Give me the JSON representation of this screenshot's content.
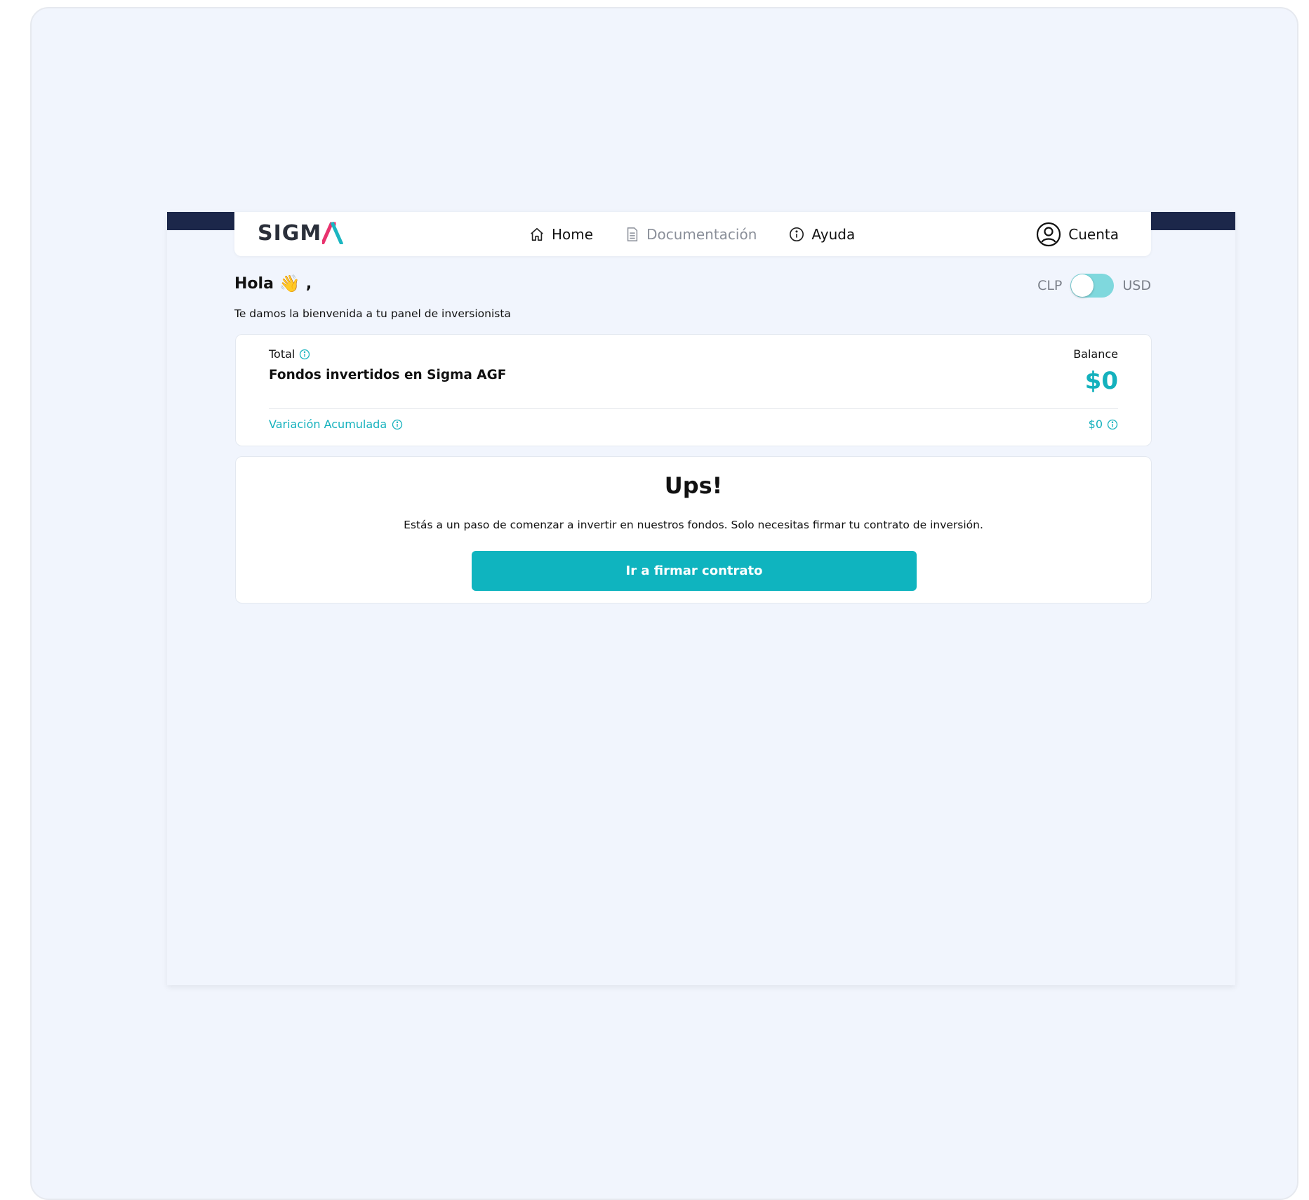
{
  "navbar": {
    "logo_text": "SIGM",
    "links": [
      {
        "label": "Home",
        "icon": "home-icon"
      },
      {
        "label": "Documentación",
        "icon": "document-icon"
      },
      {
        "label": "Ayuda",
        "icon": "info-icon"
      }
    ],
    "account_label": "Cuenta"
  },
  "greeting": {
    "title": "Hola",
    "emoji": "👋",
    "suffix": ",",
    "subtitle": "Te damos la bienvenida a tu panel de inversionista"
  },
  "currency_toggle": {
    "left_label": "CLP",
    "right_label": "USD",
    "selected": "CLP"
  },
  "summary": {
    "total_label": "Total",
    "fund_name": "Fondos invertidos en Sigma AGF",
    "balance_label": "Balance",
    "balance_value": "$0",
    "variation_label": "Variación Acumulada",
    "variation_value": "$0"
  },
  "empty_state": {
    "title": "Ups!",
    "message": "Estás a un paso de comenzar a invertir en nuestros fondos. Solo necesitas firmar tu contrato de inversión.",
    "button_label": "Ir a firmar contrato"
  },
  "colors": {
    "accent": "#0fb4bf",
    "header_band": "#1c274a",
    "background": "#f1f5fd",
    "logo_accent": "#e8336e"
  }
}
